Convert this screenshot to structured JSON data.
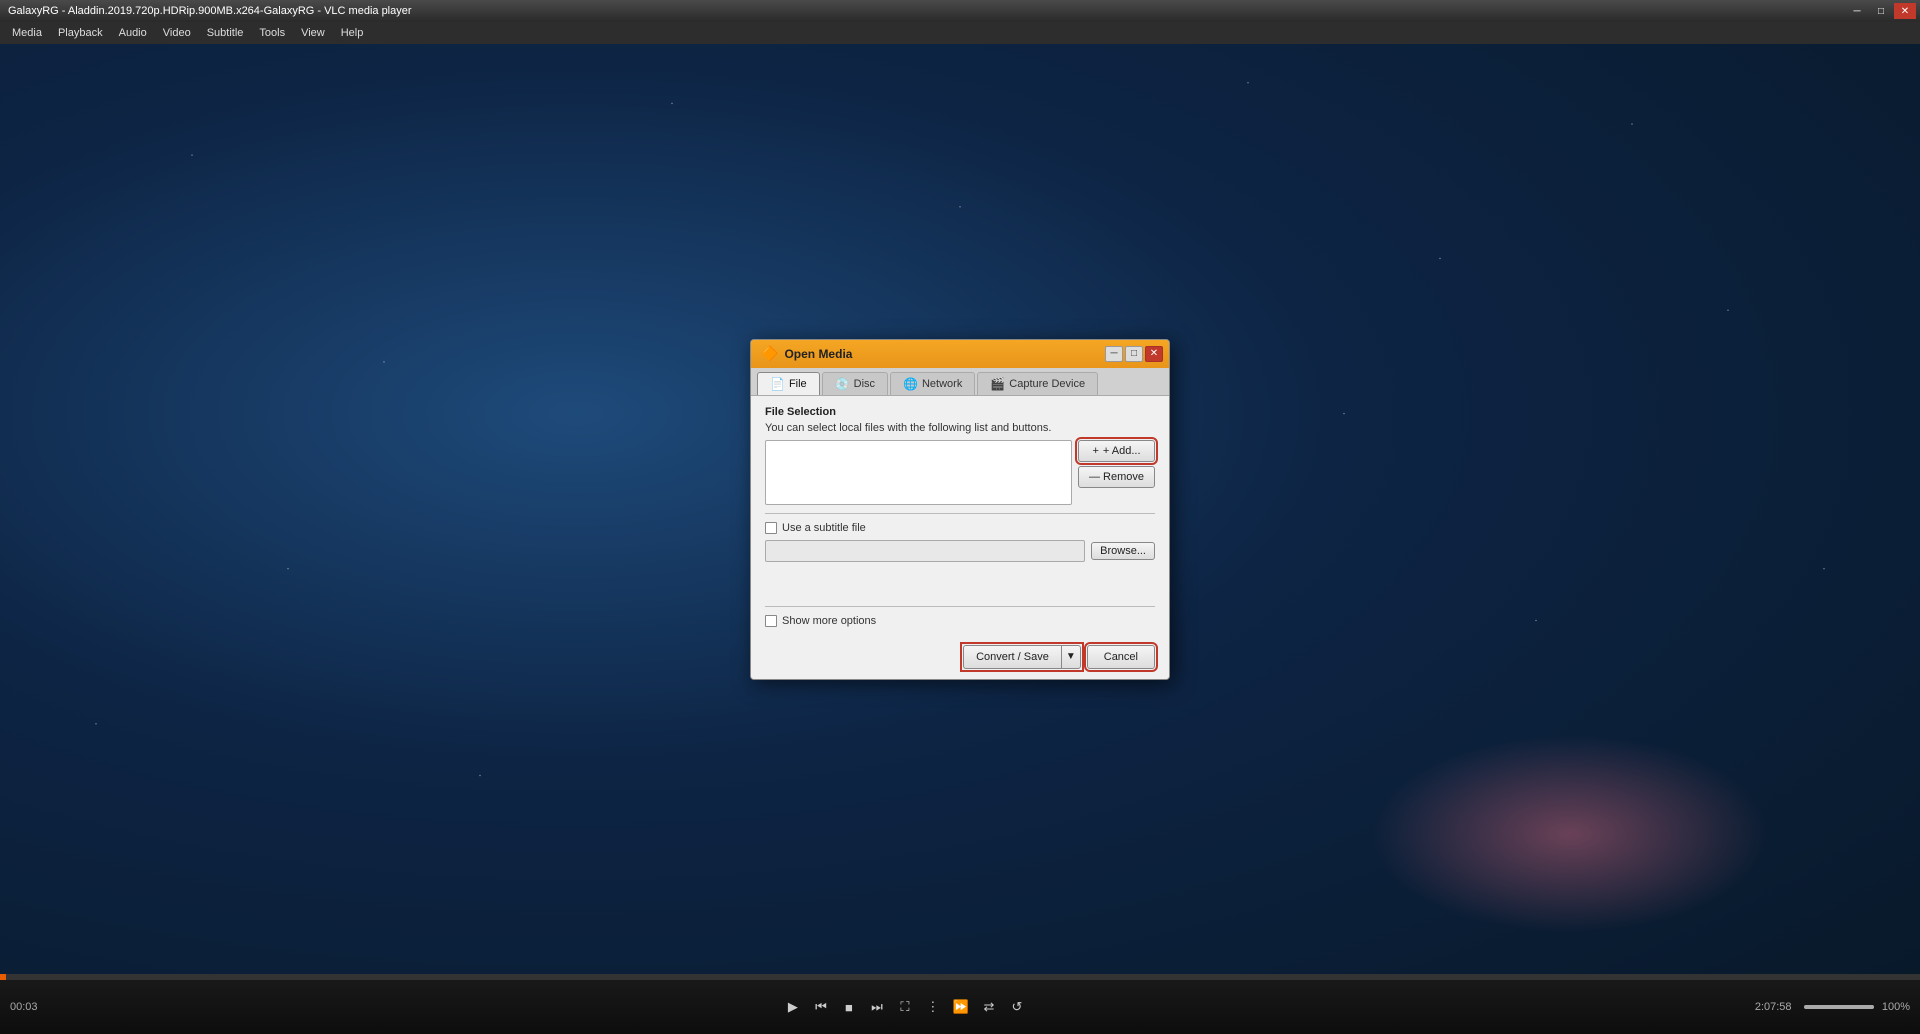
{
  "window": {
    "title": "GalaxyRG - Aladdin.2019.720p.HDRip.900MB.x264-GalaxyRG - VLC media player",
    "minimize_label": "─",
    "maximize_label": "□",
    "close_label": "✕"
  },
  "menubar": {
    "items": [
      "Media",
      "Playback",
      "Audio",
      "Video",
      "Subtitle",
      "Tools",
      "View",
      "Help"
    ]
  },
  "dialog": {
    "title": "Open Media",
    "title_icon": "🔶",
    "minimize_label": "─",
    "maximize_label": "□",
    "close_label": "✕",
    "tabs": [
      {
        "id": "file",
        "label": "File",
        "icon": "📄",
        "active": true
      },
      {
        "id": "disc",
        "label": "Disc",
        "icon": "💿",
        "active": false
      },
      {
        "id": "network",
        "label": "Network",
        "icon": "🌐",
        "active": false
      },
      {
        "id": "capture",
        "label": "Capture Device",
        "icon": "🎬",
        "active": false
      }
    ],
    "file_selection": {
      "section_title": "File Selection",
      "description": "You can select local files with the following list and buttons.",
      "add_button": "+ Add...",
      "remove_button": "— Remove",
      "subtitle_checkbox_label": "Use a subtitle file",
      "subtitle_placeholder": "",
      "browse_button": "Browse...",
      "show_more_label": "Show more options"
    },
    "footer": {
      "convert_save_label": "Convert / Save",
      "dropdown_arrow": "▼",
      "cancel_label": "Cancel"
    }
  },
  "controlbar": {
    "time_current": "00:03",
    "time_total": "2:07:58",
    "volume_pct": "100%",
    "progress_pct": 0.3
  }
}
